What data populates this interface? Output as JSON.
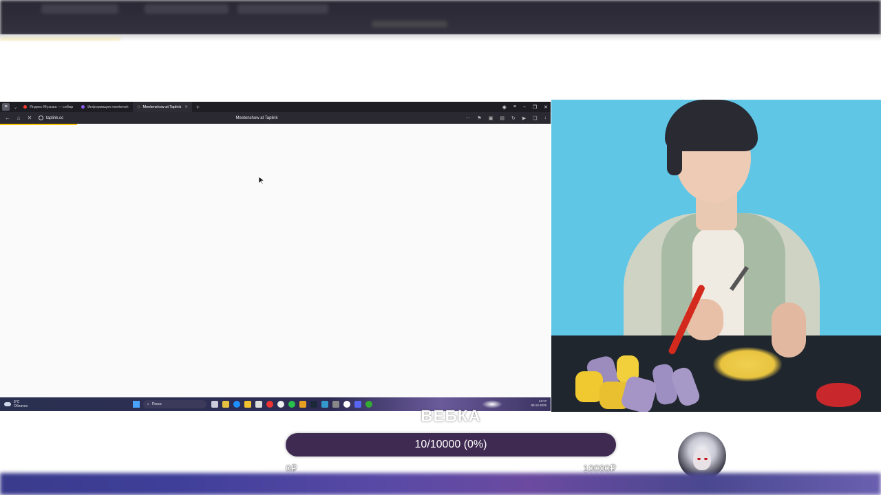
{
  "inner_browser": {
    "tabs": [
      {
        "label": "Яндекс Музыка — собир",
        "dot_color": "#ff3b30",
        "active": false
      },
      {
        "label": "Информация meetensh",
        "dot_color": "#8b5cf6",
        "active": false
      },
      {
        "label": "Meetenshow at Taplink",
        "dot_color": "#333333",
        "active": true
      }
    ],
    "new_tab_symbol": "+",
    "url": "taplink.cc",
    "page_title": "Meetenshow at Taplink",
    "load_progress": 0.14
  },
  "taskbar": {
    "weather_temp": "8°C",
    "weather_desc": "Облачно",
    "search_placeholder": "Поиск",
    "time": "14:17",
    "date": "09.10.2025"
  },
  "overlay": {
    "heading": "ВЕБКА",
    "progress_text": "10/10000 (0%)",
    "progress_fraction": 0.001,
    "min_label": "0₽",
    "max_label": "10000₽"
  },
  "colors": {
    "progress_bg": "#3f2a51",
    "webcam_bg": "#5fc6e6"
  }
}
